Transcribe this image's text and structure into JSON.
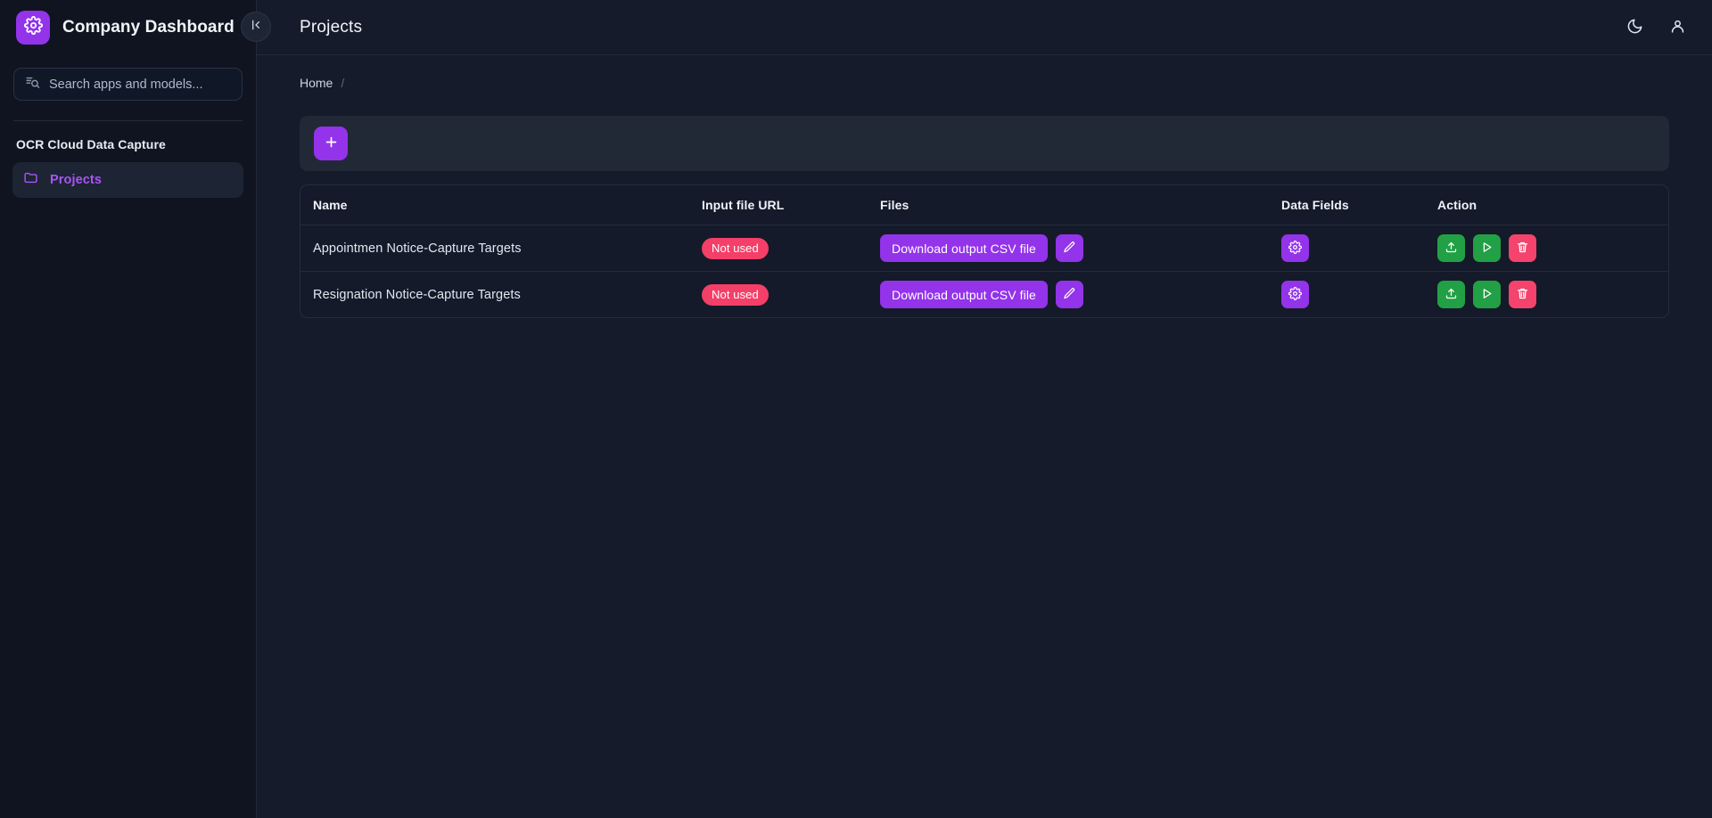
{
  "brand": {
    "title": "Company Dashboard",
    "logo_icon": "gear-icon"
  },
  "sidebar": {
    "search": {
      "placeholder": "Search apps and models...",
      "value": "",
      "icon": "text-search-icon"
    },
    "group_title": "OCR Cloud Data Capture",
    "items": [
      {
        "label": "Projects",
        "icon": "folder-icon",
        "active": true
      }
    ],
    "collapse_icon": "collapse-left-icon"
  },
  "header": {
    "title": "Projects",
    "theme_toggle_icon": "moon-icon",
    "user_icon": "user-icon"
  },
  "breadcrumb": {
    "items": [
      {
        "label": "Home"
      }
    ],
    "separator": "/"
  },
  "toolbar": {
    "add_label": "+",
    "add_icon": "plus-icon"
  },
  "table": {
    "columns": [
      "Name",
      "Input file URL",
      "Files",
      "Data Fields",
      "Action"
    ],
    "rows": [
      {
        "name": "Appointmen Notice-Capture Targets",
        "input_file_url_badge": "Not used",
        "download_label": "Download output CSV file",
        "edit_icon": "pencil-icon",
        "fields_icon": "gear-icon",
        "actions": [
          "upload-icon",
          "play-icon",
          "trash-icon"
        ]
      },
      {
        "name": "Resignation Notice-Capture Targets",
        "input_file_url_badge": "Not used",
        "download_label": "Download output CSV file",
        "edit_icon": "pencil-icon",
        "fields_icon": "gear-icon",
        "actions": [
          "upload-icon",
          "play-icon",
          "trash-icon"
        ]
      }
    ]
  },
  "colors": {
    "accent_purple": "#9333ea",
    "badge_pink": "#f43f68",
    "action_green": "#22a045",
    "action_red": "#f4436c",
    "sidebar_bg": "#0f1420",
    "main_bg": "#151b2b",
    "nav_active_text": "#a855f7"
  }
}
